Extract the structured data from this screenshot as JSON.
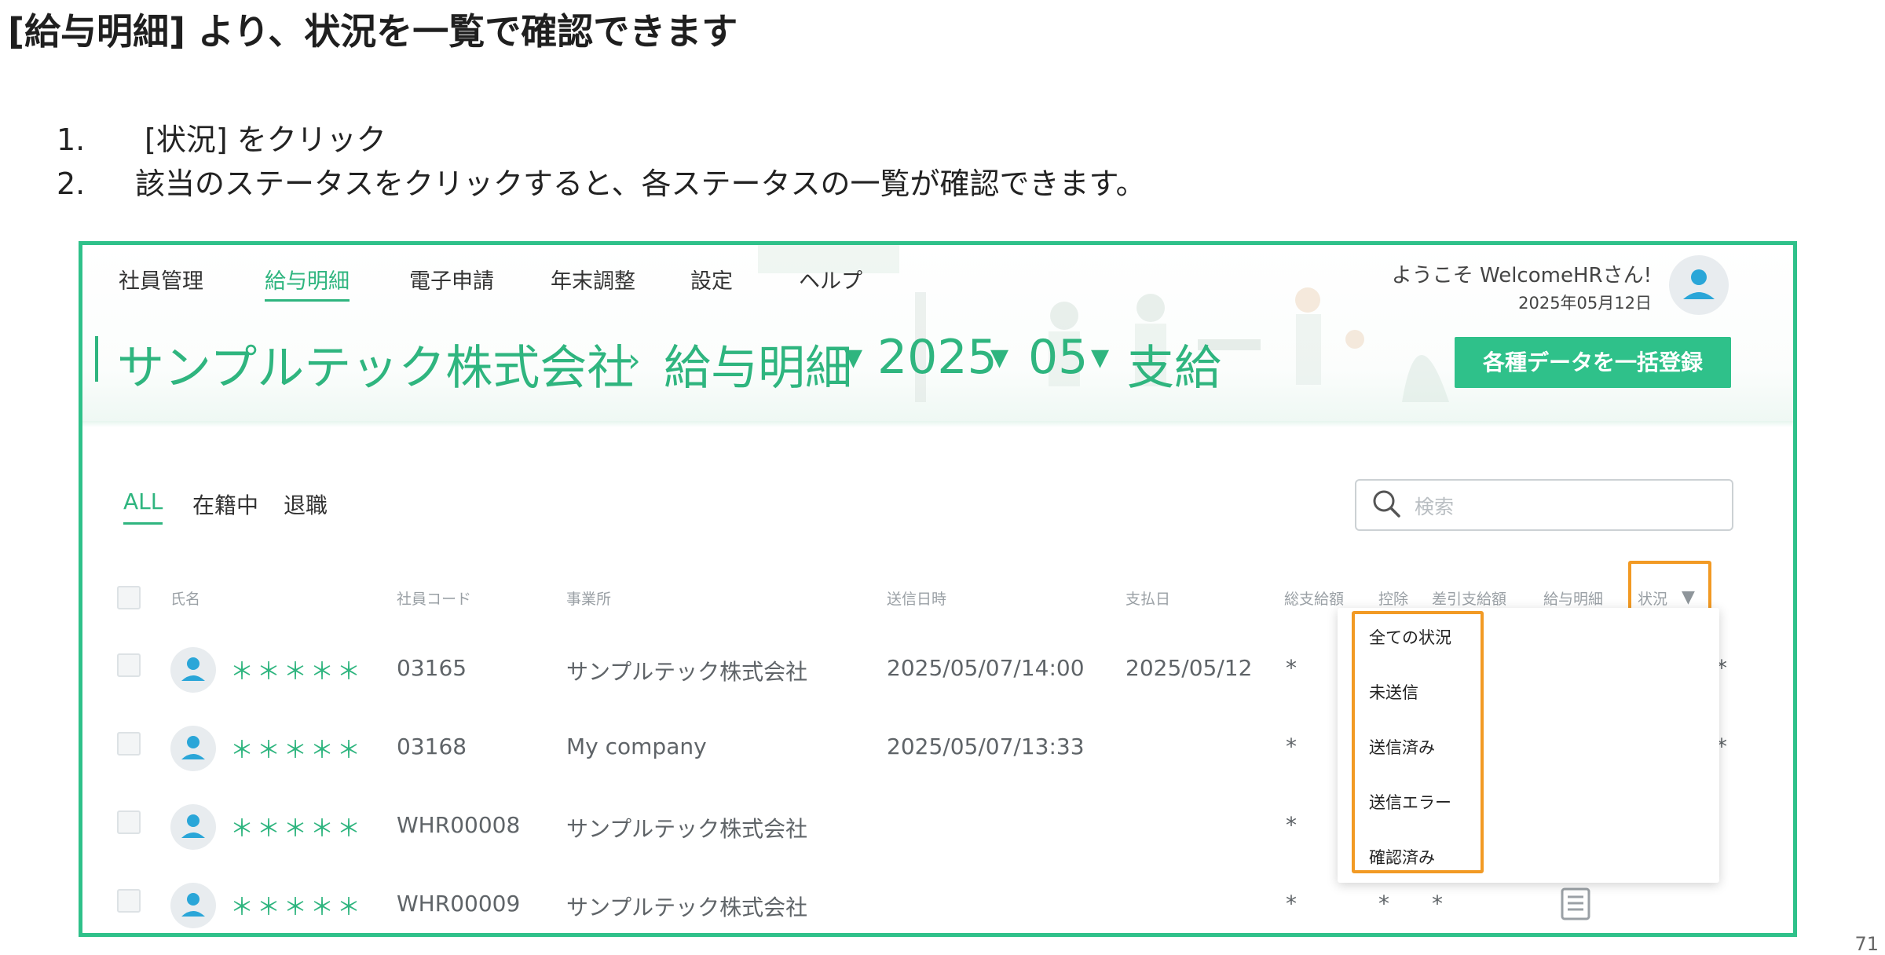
{
  "slide": {
    "title": "[給与明細] より、状況を一覧で確認できます",
    "steps": [
      {
        "num": "1.",
        "text": "[状況] をクリック"
      },
      {
        "num": "2.",
        "text": "該当のステータスをクリックすると、各ステータスの一覧が確認できます。"
      }
    ],
    "page_number": "71"
  },
  "app": {
    "nav": [
      "社員管理",
      "給与明細",
      "電子申請",
      "年末調整",
      "設定",
      "ヘルプ"
    ],
    "active_nav": "給与明細",
    "welcome": "ようこそ WelcomeHRさん!",
    "date": "2025年05月12日",
    "breadcrumb": {
      "company": "サンプルテック株式会社",
      "separator": "›",
      "section": "給与明細",
      "year": "2025",
      "month": "05",
      "type": "支給"
    },
    "bulk_button": "各種データを一括登録",
    "filter_tabs": [
      "ALL",
      "在籍中",
      "退職"
    ],
    "search_placeholder": "検索",
    "columns": [
      "氏名",
      "社員コード",
      "事業所",
      "送信日時",
      "支払日",
      "総支給額",
      "控除",
      "差引支給額",
      "給与明細",
      "状況"
    ],
    "rows": [
      {
        "name": "＊＊＊＊＊",
        "code": "03165",
        "office": "サンプルテック株式会社",
        "sent": "2025/05/07/14:00",
        "pay_date": "2025/05/12",
        "gross": "*",
        "deduction": "",
        "net": "",
        "edge": "*"
      },
      {
        "name": "＊＊＊＊＊",
        "code": "03168",
        "office": "My company",
        "sent": "2025/05/07/13:33",
        "pay_date": "",
        "gross": "*",
        "deduction": "",
        "net": "",
        "edge": "*"
      },
      {
        "name": "＊＊＊＊＊",
        "code": "WHR00008",
        "office": "サンプルテック株式会社",
        "sent": "",
        "pay_date": "",
        "gross": "*",
        "deduction": "",
        "net": "",
        "edge": ""
      },
      {
        "name": "＊＊＊＊＊",
        "code": "WHR00009",
        "office": "サンプルテック株式会社",
        "sent": "",
        "pay_date": "",
        "gross": "*",
        "deduction": "*",
        "net": "*",
        "edge": ""
      }
    ],
    "status_options": [
      "全ての状況",
      "未送信",
      "送信済み",
      "送信エラー",
      "確認済み"
    ]
  },
  "colors": {
    "accent": "#2fc18a",
    "highlight": "#f29a24"
  }
}
